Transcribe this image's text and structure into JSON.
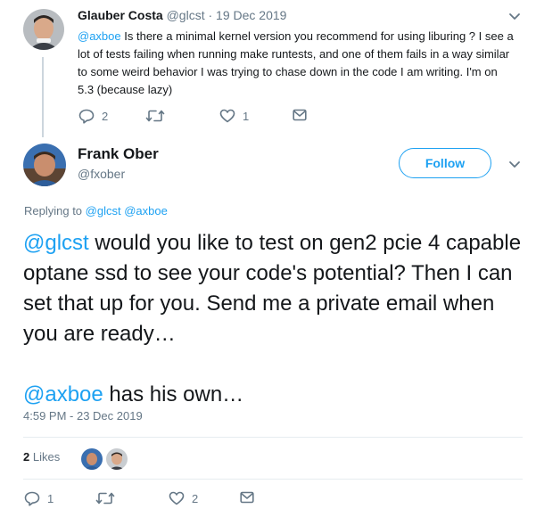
{
  "parent_tweet": {
    "name": "Glauber Costa",
    "handle": "@glcst",
    "date": "19 Dec 2019",
    "mention": "@axboe",
    "text": "Is there a minimal kernel version you recommend for using liburing ? I see a lot of tests failing when running make runtests, and one of them fails in a way similar to some weird behavior I was trying to chase down in the code I am writing. I'm on 5.3 (because lazy)",
    "reply_count": "2",
    "retweet_count": "",
    "like_count": "1"
  },
  "focused_tweet": {
    "name": "Frank Ober",
    "handle": "@fxober",
    "follow_label": "Follow",
    "replying_label": "Replying to",
    "replying_to": [
      "@glcst",
      "@axboe"
    ],
    "body_line1_mention": "@glcst",
    "body_line1_text": " would you like to test on gen2 pcie 4 capable  optane ssd to see your code's potential? Then I can set that up for you. Send me a private email when you are ready…",
    "body_line2_mention": "@axboe",
    "body_line2_text": " has his own…",
    "timestamp": "4:59 PM - 23 Dec 2019",
    "likes_count": "2",
    "likes_label": "Likes",
    "reply_count": "1",
    "retweet_count": "",
    "like_count": "2"
  },
  "colors": {
    "accent": "#1da1f2",
    "muted": "#657786",
    "text": "#14171a",
    "divider": "#e6ecf0"
  },
  "icons": {
    "reply": "reply-icon",
    "retweet": "retweet-icon",
    "like": "heart-icon",
    "dm": "envelope-icon",
    "menu": "chevron-down-icon"
  }
}
